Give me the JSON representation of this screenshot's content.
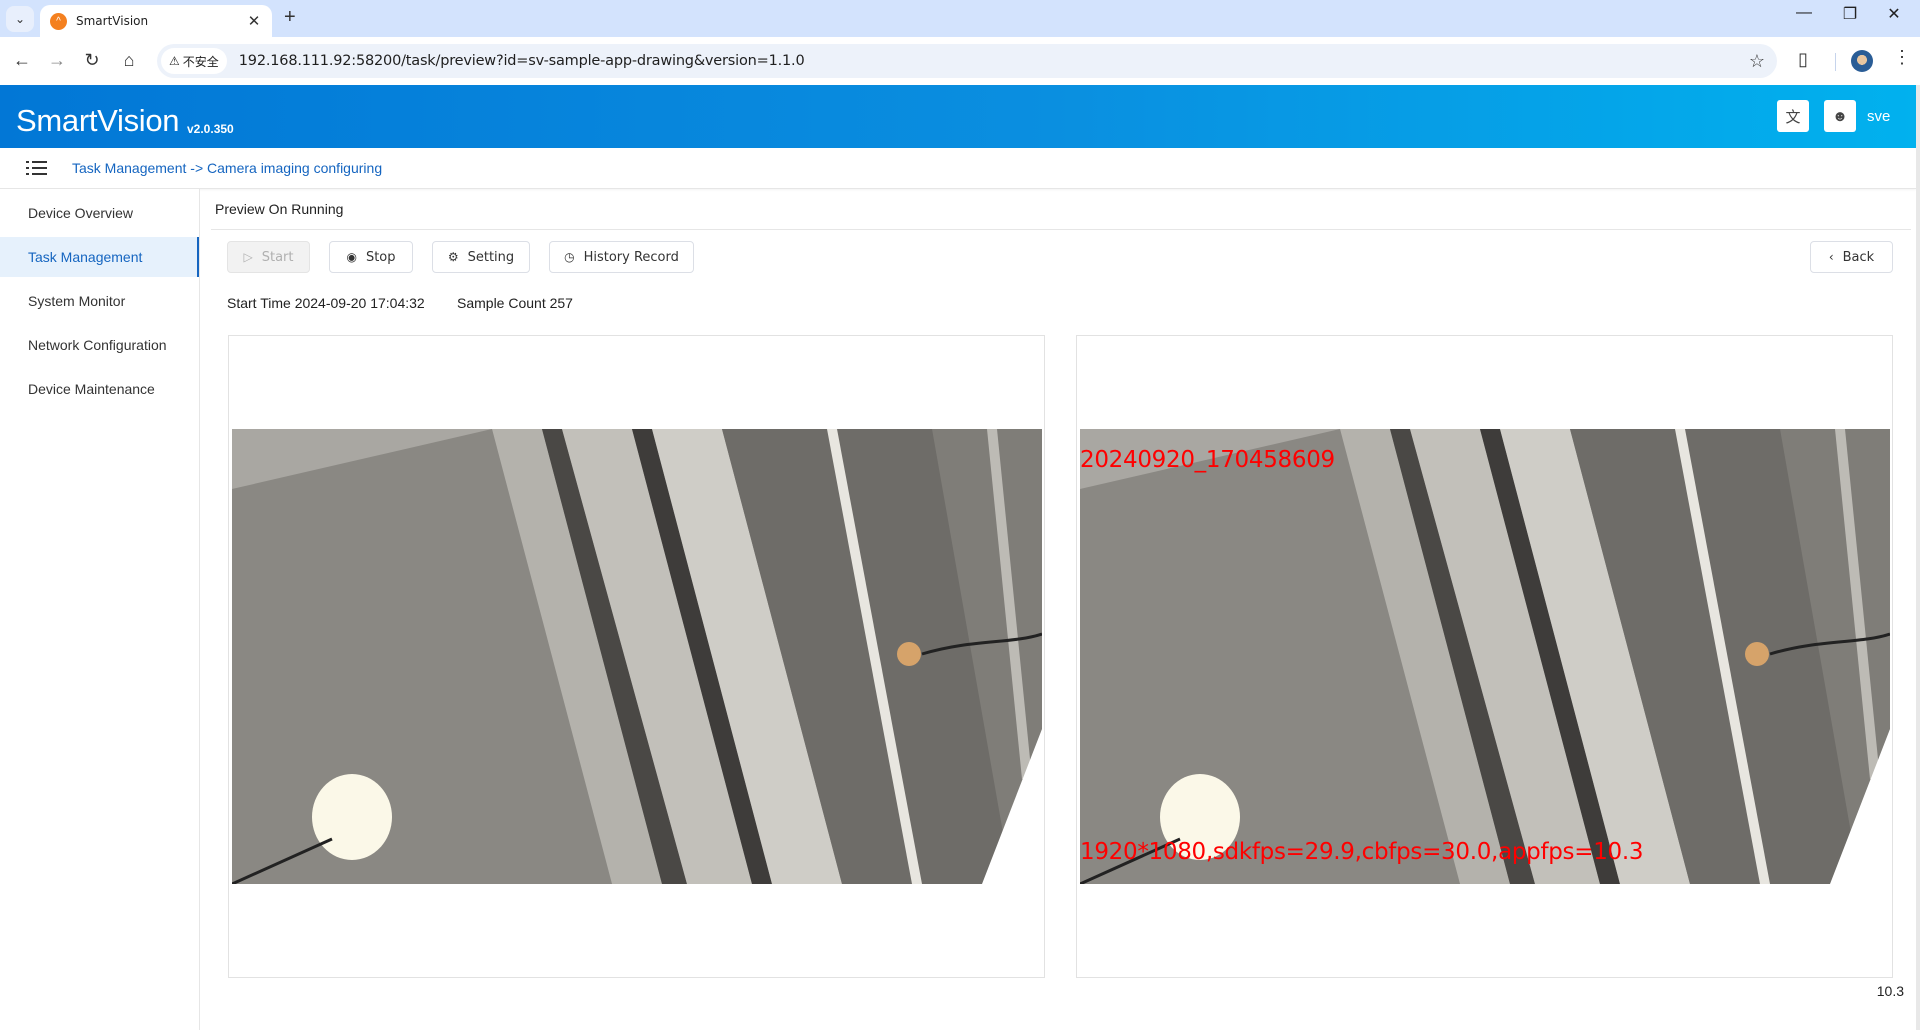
{
  "browser": {
    "tab_title": "SmartVision",
    "new_tab_label": "+",
    "security_label": "不安全",
    "url": "192.168.111.92:58200/task/preview?id=sv-sample-app-drawing&version=1.1.0"
  },
  "header": {
    "brand": "SmartVision",
    "version": "v2.0.350",
    "username": "sve",
    "brand_gradient": [
      "#0277d6",
      "#01b1ee"
    ]
  },
  "breadcrumb": {
    "text": "Task Management -> Camera imaging configuring"
  },
  "sidebar": {
    "items": [
      {
        "label": "Device Overview",
        "active": false
      },
      {
        "label": "Task Management",
        "active": true
      },
      {
        "label": "System Monitor",
        "active": false
      },
      {
        "label": "Network Configuration",
        "active": false
      },
      {
        "label": "Device Maintenance",
        "active": false
      }
    ]
  },
  "main": {
    "title": "Preview On Running",
    "buttons": {
      "start": "Start",
      "stop": "Stop",
      "setting": "Setting",
      "history": "History Record",
      "back": "Back"
    },
    "start_time_label": "Start Time",
    "start_time": "2024-09-20 17:04:32",
    "sample_count_label": "Sample Count",
    "sample_count": "257",
    "overlay_timestamp": "20240920_170458609",
    "overlay_stats": "1920*1080,sdkfps=29.9,cbfps=30.0,appfps=10.3",
    "fps_readout": "10.3",
    "overlay_color": "#ff0000",
    "accent_color": "#1565c0"
  }
}
